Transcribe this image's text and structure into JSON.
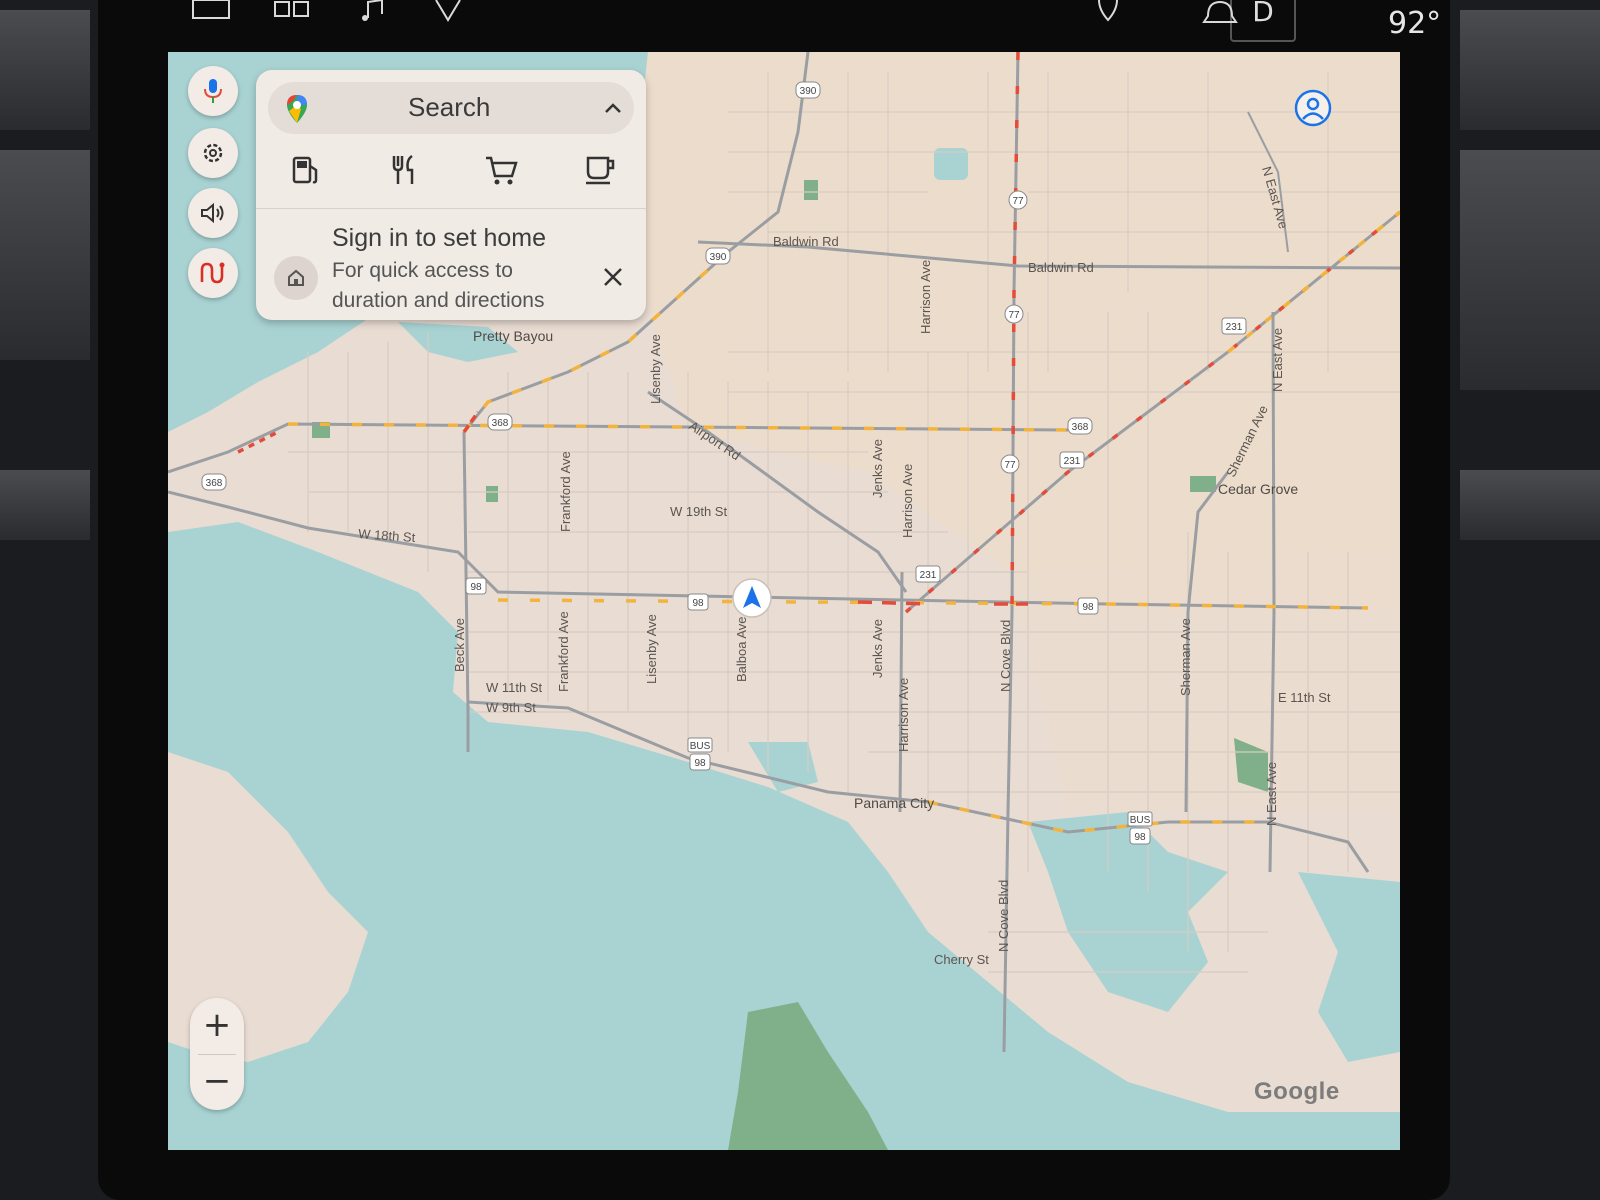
{
  "status_bar": {
    "temperature": "92°",
    "gear": "D",
    "icons": [
      "window-icon",
      "grid-icon",
      "music-icon",
      "navigation-icon",
      "location-icon",
      "bell-icon"
    ]
  },
  "search_card": {
    "search_label": "Search",
    "categories": [
      "gas-station-icon",
      "restaurant-icon",
      "shopping-cart-icon",
      "coffee-icon"
    ],
    "signin_title": "Sign in to set home",
    "signin_subtitle": "For quick access to duration and directions"
  },
  "side_buttons": [
    "microphone-icon",
    "settings-icon",
    "volume-icon",
    "route-icon"
  ],
  "zoom": {
    "in": "+",
    "out": "−"
  },
  "attribution": "Google",
  "map_labels": {
    "baldwin_rd_1": "Baldwin Rd",
    "baldwin_rd_2": "Baldwin Rd",
    "pretty_bayou": "Pretty Bayou",
    "airport_rd": "Airport Rd",
    "w19th": "W 19th St",
    "w18th": "W 18th St",
    "w11th": "W 11th St",
    "w9th": "W 9th St",
    "e11th": "E 11th St",
    "cherry_st": "Cherry St",
    "panama_city": "Panama City",
    "cedar_grove": "Cedar Grove",
    "beck_ave": "Beck Ave",
    "frankford_ave_1": "Frankford Ave",
    "frankford_ave_2": "Frankford Ave",
    "lisenby_ave_1": "Lisenby Ave",
    "lisenby_ave_2": "Lisenby Ave",
    "balboa_ave": "Balboa Ave",
    "jenks_ave_1": "Jenks Ave",
    "jenks_ave_2": "Jenks Ave",
    "harrison_ave_1": "Harrison Ave",
    "harrison_ave_2": "Harrison Ave",
    "harrison_ave_3": "Harrison Ave",
    "n_cove_blvd_1": "N Cove Blvd",
    "n_cove_blvd_2": "N Cove Blvd",
    "sherman_ave_1": "Sherman Ave",
    "sherman_ave_2": "Sherman Ave",
    "n_east_ave_1": "N East Ave",
    "n_east_ave_2": "N East Ave",
    "n_east_ave_3": "N East Ave"
  },
  "shields": {
    "s390a": "390",
    "s390b": "390",
    "s77a": "77",
    "s77b": "77",
    "s77c": "77",
    "s368a": "368",
    "s368b": "368",
    "s368c": "368",
    "s231a": "231",
    "s231b": "231",
    "s231c": "231",
    "s98a": "98",
    "s98b": "98",
    "s98c": "98",
    "s98d": "98",
    "s98e": "98",
    "bus1": "BUS",
    "bus2": "BUS"
  },
  "colors": {
    "land": "#e9dcd3",
    "water": "#a9d3d3",
    "park": "#7fb08a",
    "traffic_slow": "#f2b43c",
    "traffic_heavy": "#e34b3a",
    "nav_arrow": "#1a73e8"
  }
}
